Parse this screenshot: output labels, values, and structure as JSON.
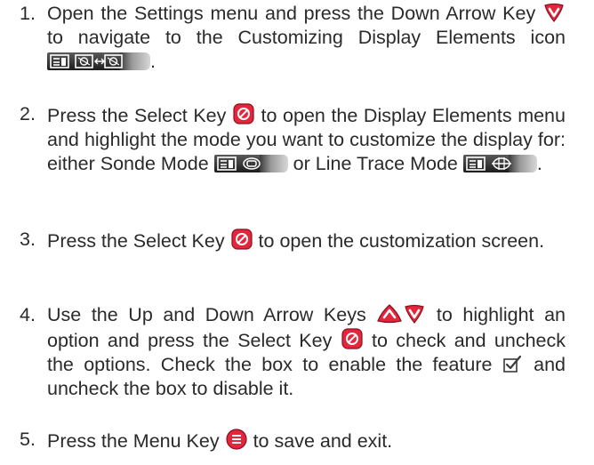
{
  "steps": [
    {
      "number": "1.",
      "text1": "Open the Settings menu and press the Down Arrow Key",
      "text2": "to navigate to the Customizing Display Elements icon",
      "text3": "."
    },
    {
      "number": "2.",
      "text1": "Press the Select Key",
      "text2": "to open the Display Elements menu and highlight the mode you want to customize the display for: either Sonde Mode",
      "text3": "or Line Trace Mode",
      "text4": "."
    },
    {
      "number": "3.",
      "text1": "Press the Select Key",
      "text2": "to open the customization screen."
    },
    {
      "number": "4.",
      "text1": "Use the Up and Down Arrow Keys",
      "text2": "to highlight an option and press the Select Key",
      "text3": "to check and uncheck the options. Check the box to enable the feature",
      "text4": "and uncheck the box to disable it."
    },
    {
      "number": "5.",
      "text1": "Press the Menu Key",
      "text2": "to save and exit."
    }
  ],
  "colors": {
    "key_red": "#e3263b",
    "text": "#2a2a2a",
    "icon_bar": "#2b2b2b"
  },
  "icons": [
    "down-arrow-key-icon",
    "customize-display-icon",
    "select-key-icon",
    "sonde-mode-icon",
    "line-trace-mode-icon",
    "up-arrow-key-icon",
    "checked-box-icon",
    "menu-key-icon"
  ]
}
